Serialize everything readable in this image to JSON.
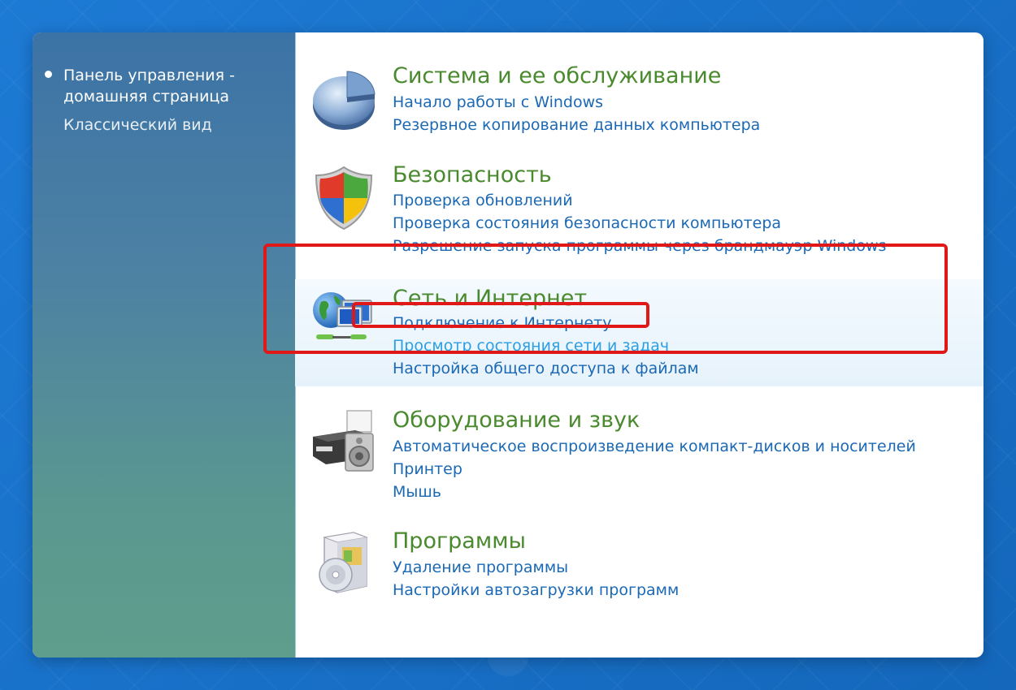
{
  "sidebar": {
    "current_link": "Панель управления -\nдомашняя страница",
    "current_line1": "Панель управления -",
    "current_line2": "домашняя страница",
    "classic_view": "Классический вид"
  },
  "categories": [
    {
      "icon": "system-maintenance-icon",
      "title": "Система и ее обслуживание",
      "links": [
        "Начало работы с Windows",
        "Резервное копирование данных компьютера"
      ]
    },
    {
      "icon": "security-shield-icon",
      "title": "Безопасность",
      "links": [
        "Проверка обновлений",
        "Проверка состояния безопасности компьютера",
        "Разрешение запуска программы через брандмауэр Windows"
      ]
    },
    {
      "icon": "network-internet-icon",
      "title": "Сеть и Интернет",
      "links": [
        "Подключение к Интернету",
        "Просмотр состояния сети и задач",
        "Настройка общего доступа к файлам"
      ],
      "highlighted": true
    },
    {
      "icon": "printer-hardware-sound-icon",
      "title": "Оборудование и звук",
      "links": [
        "Автоматическое воспроизведение компакт-дисков и носителей",
        "Принтер",
        "Мышь"
      ]
    },
    {
      "icon": "programs-box-cd-icon",
      "title": "Программы",
      "links": [
        "Удаление программы",
        "Настройки автозагрузки программ"
      ]
    }
  ],
  "colors": {
    "category_title": "#4a8a2e",
    "link": "#1b69b5",
    "highlight_border": "#e01818"
  }
}
